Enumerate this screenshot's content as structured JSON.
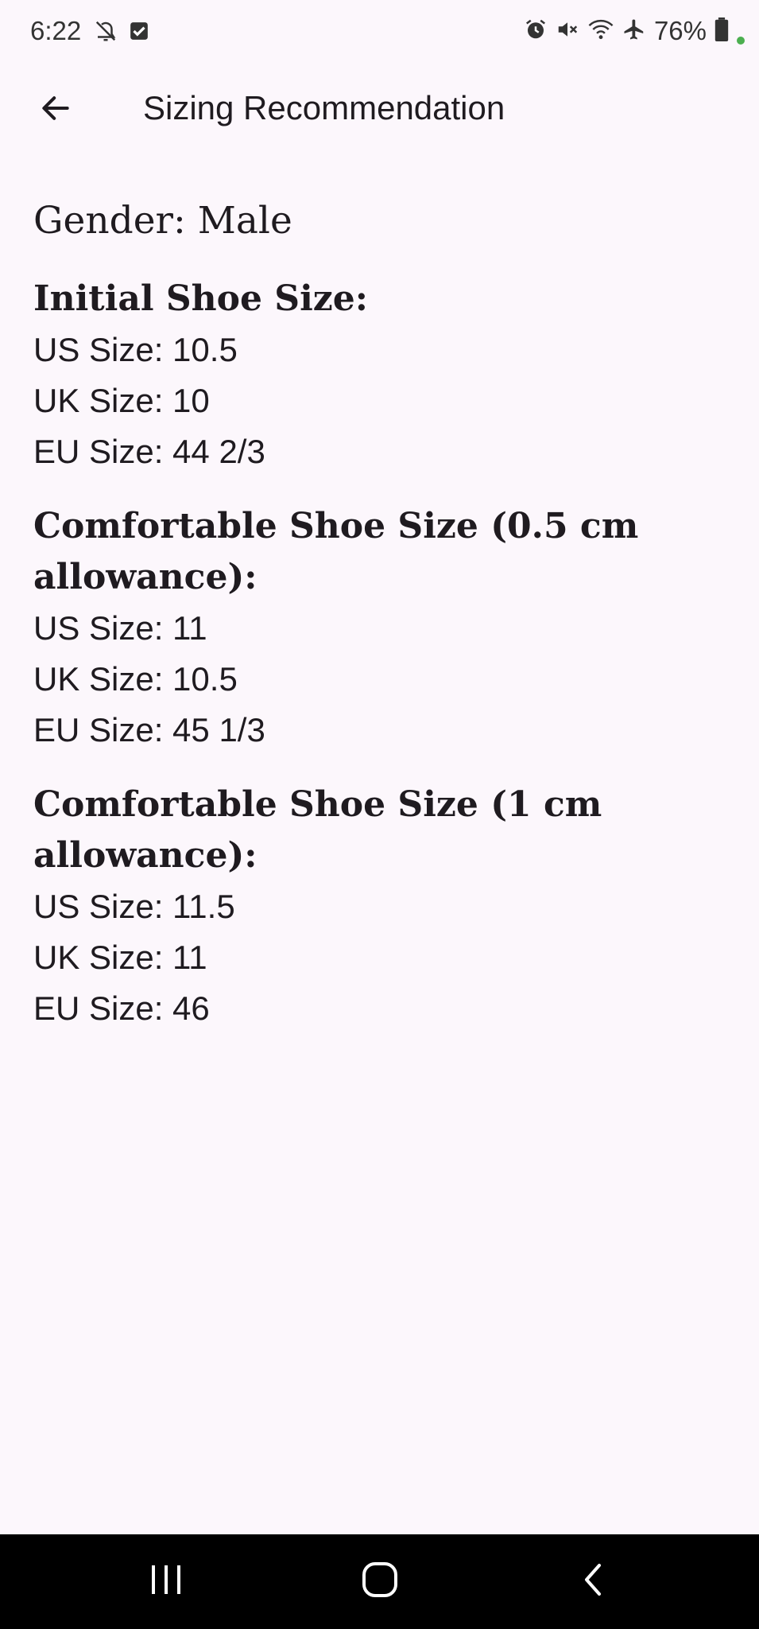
{
  "status_bar": {
    "time": "6:22",
    "battery_percent": "76%",
    "left_icons": [
      "notifications-off-icon",
      "checkbox-icon"
    ],
    "right_icons": [
      "alarm-icon",
      "mute-icon",
      "wifi-icon",
      "airplane-icon",
      "battery-icon"
    ],
    "indicator_color": "#4caf50"
  },
  "app_bar": {
    "title": "Sizing Recommendation",
    "back_icon": "arrow-back-icon"
  },
  "content": {
    "gender": "Gender: Male",
    "sections": [
      {
        "heading": "Initial Shoe Size:",
        "us": "US Size: 10.5",
        "uk": "UK Size: 10",
        "eu": "EU Size: 44 2/3"
      },
      {
        "heading": "Comfortable Shoe Size (0.5 cm allowance):",
        "us": "US Size: 11",
        "uk": "UK Size: 10.5",
        "eu": "EU Size: 45 1/3"
      },
      {
        "heading": "Comfortable Shoe Size (1 cm allowance):",
        "us": "US Size: 11.5",
        "uk": "UK Size: 11",
        "eu": "EU Size: 46"
      }
    ]
  },
  "nav_bar": {
    "buttons": [
      "recent-apps-icon",
      "home-icon",
      "back-icon"
    ]
  },
  "colors": {
    "background": "#fcf7fc",
    "text": "#1f1b20",
    "nav_bar": "#000000"
  }
}
